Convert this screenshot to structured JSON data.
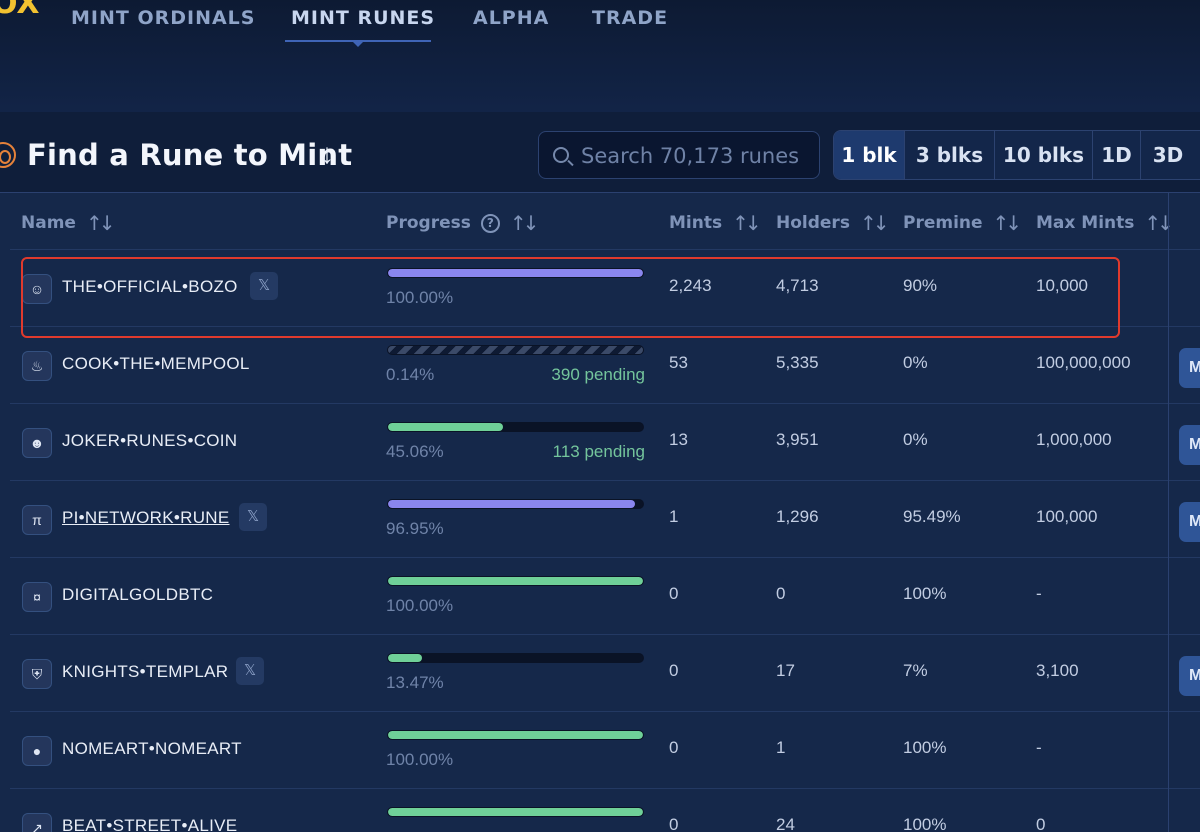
{
  "brand": {
    "logo_text": "OX"
  },
  "nav": {
    "items": [
      {
        "label": "MINT ORDINALS",
        "active": false
      },
      {
        "label": "MINT RUNES",
        "active": true
      },
      {
        "label": "ALPHA",
        "active": false
      },
      {
        "label": "TRADE",
        "active": false
      }
    ]
  },
  "heading": {
    "title": "Find a Rune to Mint",
    "arrow": "↓"
  },
  "search": {
    "placeholder": "Search 70,173 runes",
    "value": ""
  },
  "timeframes": {
    "options": [
      "1 blk",
      "3 blks",
      "10 blks",
      "1D",
      "3D"
    ],
    "selected": "1 blk"
  },
  "table": {
    "columns": {
      "name": "Name",
      "progress": "Progress",
      "mints": "Mints",
      "holders": "Holders",
      "premine": "Premine",
      "max_mints": "Max Mints"
    },
    "rows": [
      {
        "name": "THE•OFFICIAL•BOZO",
        "has_x": true,
        "progress_label": "100.00%",
        "progress": 1.0,
        "bar_color": "purple",
        "pending": "",
        "mints": "2,243",
        "holders": "4,713",
        "premine": "90%",
        "max_mints": "10,000",
        "mint_button": ""
      },
      {
        "name": "COOK•THE•MEMPOOL",
        "has_x": false,
        "progress_label": "0.14%",
        "progress": 0.0014,
        "bar_color": "striped",
        "pending": "390 pending",
        "mints": "53",
        "holders": "5,335",
        "premine": "0%",
        "max_mints": "100,000,000",
        "mint_button": "M"
      },
      {
        "name": "JOKER•RUNES•COIN",
        "has_x": false,
        "progress_label": "45.06%",
        "progress": 0.4506,
        "bar_color": "green",
        "pending": "113 pending",
        "mints": "13",
        "holders": "3,951",
        "premine": "0%",
        "max_mints": "1,000,000",
        "mint_button": "M"
      },
      {
        "name": "PI•NETWORK•RUNE",
        "has_x": true,
        "progress_label": "96.95%",
        "progress": 0.9695,
        "bar_color": "purple",
        "pending": "",
        "mints": "1",
        "holders": "1,296",
        "premine": "95.49%",
        "max_mints": "100,000",
        "mint_button": "M"
      },
      {
        "name": "DIGITALGOLDBTC",
        "has_x": false,
        "progress_label": "100.00%",
        "progress": 1.0,
        "bar_color": "green",
        "pending": "",
        "mints": "0",
        "holders": "0",
        "premine": "100%",
        "max_mints": "-",
        "mint_button": ""
      },
      {
        "name": "KNIGHTS•TEMPLAR",
        "has_x": true,
        "progress_label": "13.47%",
        "progress": 0.1347,
        "bar_color": "green",
        "pending": "",
        "mints": "0",
        "holders": "17",
        "premine": "7%",
        "max_mints": "3,100",
        "mint_button": "M"
      },
      {
        "name": "NOMEART•NOMEART",
        "has_x": false,
        "progress_label": "100.00%",
        "progress": 1.0,
        "bar_color": "green",
        "pending": "",
        "mints": "0",
        "holders": "1",
        "premine": "100%",
        "max_mints": "-",
        "mint_button": ""
      },
      {
        "name": "BEAT•STREET•ALIVE",
        "has_x": false,
        "progress_label": "",
        "progress": 1.0,
        "bar_color": "green",
        "pending": "",
        "mints": "0",
        "holders": "24",
        "premine": "100%",
        "max_mints": "0",
        "mint_button": ""
      }
    ]
  },
  "colors": {
    "purple": "#8a86ee",
    "green": "#6fd098",
    "highlight": "#e03a2d",
    "accent": "#3f64b6"
  },
  "icons": {
    "x_badge": "𝕏",
    "rune_icons": [
      "bozo-avatar-icon",
      "steam-icon",
      "joker-icon",
      "pi-icon",
      "grid-icon",
      "shield-icon",
      "circle-icon",
      "arrow-icon"
    ]
  }
}
